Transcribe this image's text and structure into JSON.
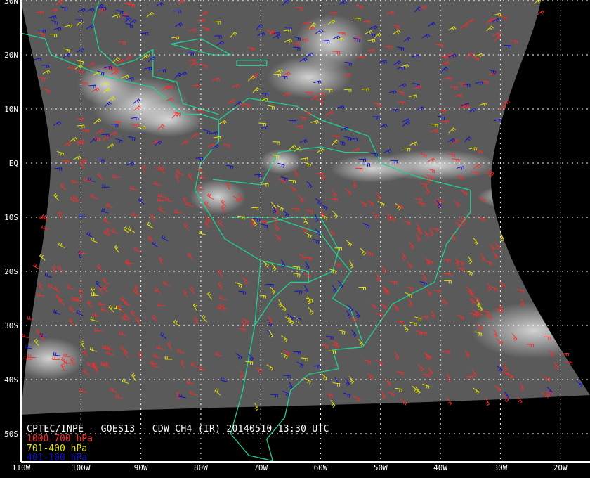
{
  "title": "CPTEC/INPE - GOES13 - CDW CH4 (IR) 20140510 13:30 UTC",
  "legend": [
    {
      "label": "1000-700 hPa",
      "color": "#ff2a2a"
    },
    {
      "label": "701-400 hPa",
      "color": "#e6e600"
    },
    {
      "label": "401-100 hPa",
      "color": "#1010d0"
    }
  ],
  "lat_labels": [
    "30N",
    "20N",
    "10N",
    "EQ",
    "10S",
    "20S",
    "30S",
    "40S",
    "50S"
  ],
  "lon_labels": [
    "110W",
    "100W",
    "90W",
    "80W",
    "70W",
    "60W",
    "50W",
    "40W",
    "30W",
    "20W"
  ],
  "coastline_color": "#20d090",
  "grid": true
}
